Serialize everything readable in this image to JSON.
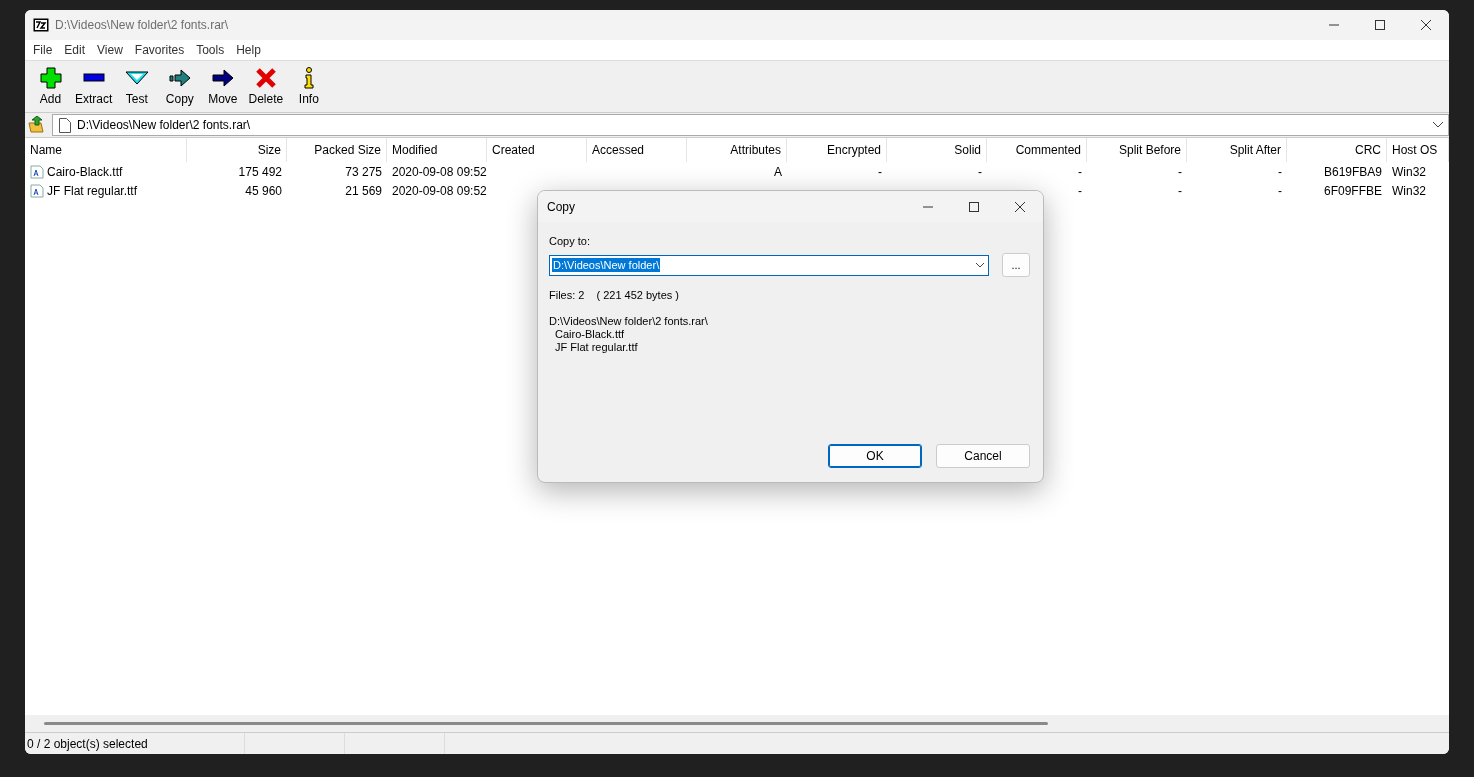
{
  "window": {
    "title": "D:\\Videos\\New folder\\2 fonts.rar\\"
  },
  "menu": [
    "File",
    "Edit",
    "View",
    "Favorites",
    "Tools",
    "Help"
  ],
  "toolbar": [
    {
      "kind": "add",
      "label": "Add"
    },
    {
      "kind": "extract",
      "label": "Extract"
    },
    {
      "kind": "test",
      "label": "Test"
    },
    {
      "kind": "copy",
      "label": "Copy"
    },
    {
      "kind": "move",
      "label": "Move"
    },
    {
      "kind": "delete",
      "label": "Delete"
    },
    {
      "kind": "info",
      "label": "Info"
    }
  ],
  "address": {
    "value": "D:\\Videos\\New folder\\2 fonts.rar\\"
  },
  "table": {
    "columns": [
      "Name",
      "Size",
      "Packed Size",
      "Modified",
      "Created",
      "Accessed",
      "Attributes",
      "Encrypted",
      "Solid",
      "Commented",
      "Split Before",
      "Split After",
      "CRC",
      "Host OS"
    ],
    "rows": [
      {
        "cells": [
          "Cairo-Black.ttf",
          "175 492",
          "73 275",
          "2020-09-08 09:52",
          "",
          "",
          "A",
          "-",
          "-",
          "-",
          "-",
          "-",
          "B619FBA9",
          "Win32"
        ]
      },
      {
        "cells": [
          "JF Flat regular.ttf",
          "45 960",
          "21 569",
          "2020-09-08 09:52",
          "",
          "",
          "",
          "",
          "",
          "-",
          "-",
          "-",
          "6F09FFBE",
          "Win32"
        ]
      }
    ]
  },
  "dialog": {
    "title": "Copy",
    "label": "Copy to:",
    "destination": {
      "value": "D:\\Videos\\New folder\\",
      "selected": true
    },
    "browse_button": "...",
    "file_count": "Files: 2",
    "byte_count": "( 221 452 bytes )",
    "source_path": "D:\\Videos\\New folder\\2 fonts.rar\\",
    "files": [
      "Cairo-Black.ttf",
      "JF Flat regular.ttf"
    ],
    "buttons": [
      {
        "label": "OK",
        "default": true
      },
      {
        "label": "Cancel",
        "default": false
      }
    ]
  },
  "status_bar": [
    "0 / 2 object(s) selected"
  ]
}
